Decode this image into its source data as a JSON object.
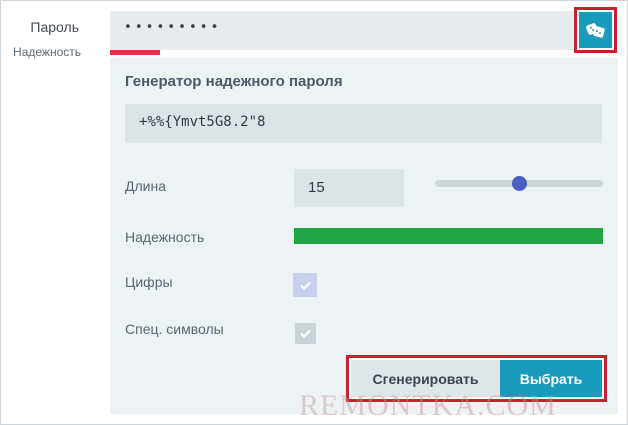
{
  "field": {
    "label": "Пароль",
    "strength_label": "Надежность",
    "password_masked": "•••••••••",
    "strength_fraction": 0.1,
    "generate_icon": "dice-icon"
  },
  "generator": {
    "title": "Генератор надежного пароля",
    "generated_password": "+%%{Ymvt5G8.2\"8",
    "length_label": "Длина",
    "length_value": "15",
    "length_slider_fraction": 0.5,
    "strength_label": "Надежность",
    "strength_fraction": 1.0,
    "digits_label": "Цифры",
    "digits_checked": true,
    "symbols_label": "Спец. символы",
    "symbols_checked": true,
    "generate_button": "Сгенерировать",
    "select_button": "Выбрать"
  },
  "colors": {
    "accent": "#1a9bbd",
    "weak": "#d9344a",
    "strong": "#21a645",
    "slider_thumb": "#4a5fc1",
    "highlight": "#cc1e2c"
  },
  "watermark": "REMONTKA.COM"
}
